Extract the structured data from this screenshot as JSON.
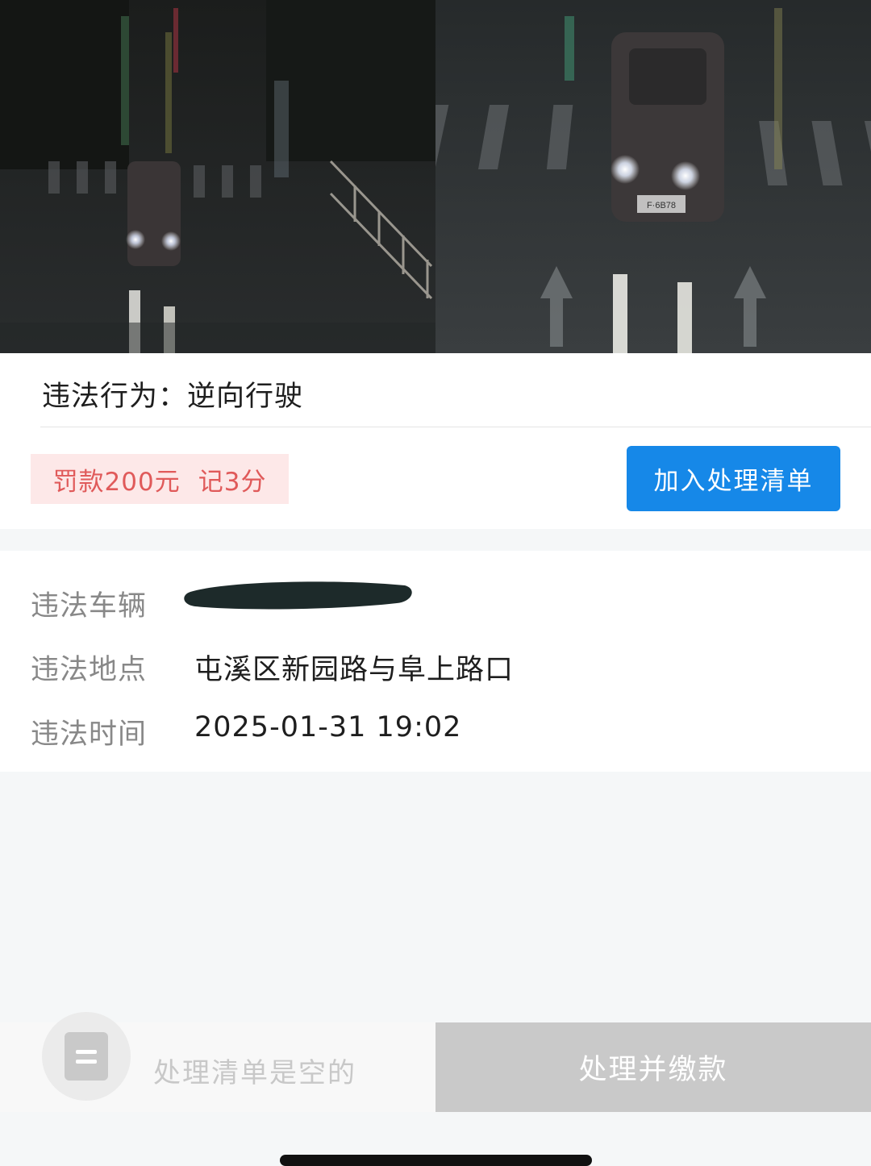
{
  "photos": {
    "left_alt": "violation-photo-1",
    "right_alt": "violation-photo-2",
    "right_plate_text": "F·6B78"
  },
  "violation": {
    "label": "违法行为：",
    "behavior": "逆向行驶",
    "fine": "罚款200元",
    "points": "记3分",
    "add_button": "加入处理清单"
  },
  "details": [
    {
      "label": "违法车辆",
      "value": ""
    },
    {
      "label": "违法地点",
      "value": "屯溪区新园路与阜上路口"
    },
    {
      "label": "违法时间",
      "value": "2025-01-31 19:02"
    }
  ],
  "bottom_bar": {
    "icon": "list-icon",
    "empty_text": "处理清单是空的",
    "pay_button": "处理并缴款"
  },
  "colors": {
    "primary": "#1688e8",
    "fine_text": "#e05a5a",
    "fine_bg": "#fde8e8",
    "disabled": "#c9c9c9"
  }
}
